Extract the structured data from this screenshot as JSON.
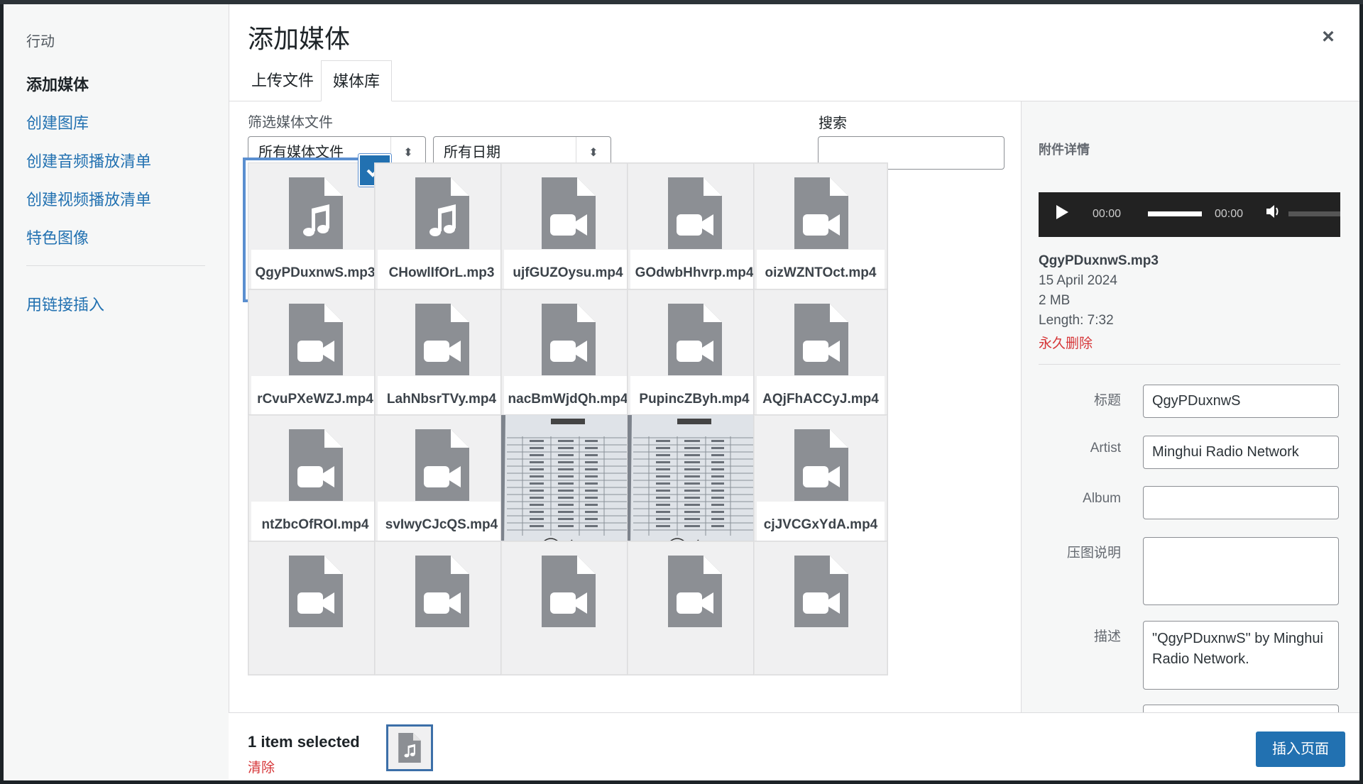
{
  "modal": {
    "title": "添加媒体",
    "close_label": "×"
  },
  "menu": {
    "heading": "行动",
    "items": [
      {
        "label": "添加媒体",
        "active": true
      },
      {
        "label": "创建图库"
      },
      {
        "label": "创建音频播放清单"
      },
      {
        "label": "创建视频播放清单"
      },
      {
        "label": "特色图像"
      }
    ],
    "insert_link": "用链接插入"
  },
  "tabs": [
    {
      "label": "上传文件"
    },
    {
      "label": "媒体库",
      "active": true
    }
  ],
  "filters": {
    "label": "筛选媒体文件",
    "type_select": "所有媒体文件",
    "date_select": "所有日期",
    "search_label": "搜索",
    "search_value": ""
  },
  "grid": [
    {
      "name": "QgyPDuxnwS.mp3",
      "kind": "audio",
      "selected": true
    },
    {
      "name": "CHowlIfOrL.mp3",
      "kind": "audio"
    },
    {
      "name": "ujfGUZOysu.mp4",
      "kind": "video"
    },
    {
      "name": "GOdwbHhvrp.mp4",
      "kind": "video"
    },
    {
      "name": "oizWZNTOct.mp4",
      "kind": "video"
    },
    {
      "name": "rCvuPXeWZJ.mp4",
      "kind": "video"
    },
    {
      "name": "LahNbsrTVy.mp4",
      "kind": "video"
    },
    {
      "name": "nacBmWjdQh.mp4",
      "kind": "video"
    },
    {
      "name": "PupincZByh.mp4",
      "kind": "video"
    },
    {
      "name": "AQjFhACCyJ.mp4",
      "kind": "video"
    },
    {
      "name": "ntZbcOfROI.mp4",
      "kind": "video"
    },
    {
      "name": "svIwyCJcQS.mp4",
      "kind": "video"
    },
    {
      "name": "",
      "kind": "photo"
    },
    {
      "name": "",
      "kind": "photo"
    },
    {
      "name": "cjJVCGxYdA.mp4",
      "kind": "video"
    },
    {
      "name": "",
      "kind": "video"
    },
    {
      "name": "",
      "kind": "video"
    },
    {
      "name": "",
      "kind": "video"
    },
    {
      "name": "",
      "kind": "video"
    },
    {
      "name": "",
      "kind": "video"
    }
  ],
  "details": {
    "heading": "附件详情",
    "player": {
      "current_time": "00:00",
      "duration": "00:00"
    },
    "filename": "QgyPDuxnwS.mp3",
    "date": "15 April 2024",
    "size": "2 MB",
    "length": "Length: 7:32",
    "delete_label": "永久删除",
    "fields": {
      "title_label": "标题",
      "title_value": "QgyPDuxnwS",
      "artist_label": "Artist",
      "artist_value": "Minghui Radio Network",
      "album_label": "Album",
      "album_value": "",
      "caption_label": "压图说明",
      "caption_value": "",
      "description_label": "描述",
      "description_value": "\"QgyPDuxnwS\" by Minghui Radio Network."
    }
  },
  "toolbar": {
    "selected_count": "1 item selected",
    "clear_label": "清除",
    "insert_label": "插入页面"
  },
  "colors": {
    "accent": "#2271b1",
    "danger": "#d63638",
    "selection": "#5b8fd0"
  }
}
